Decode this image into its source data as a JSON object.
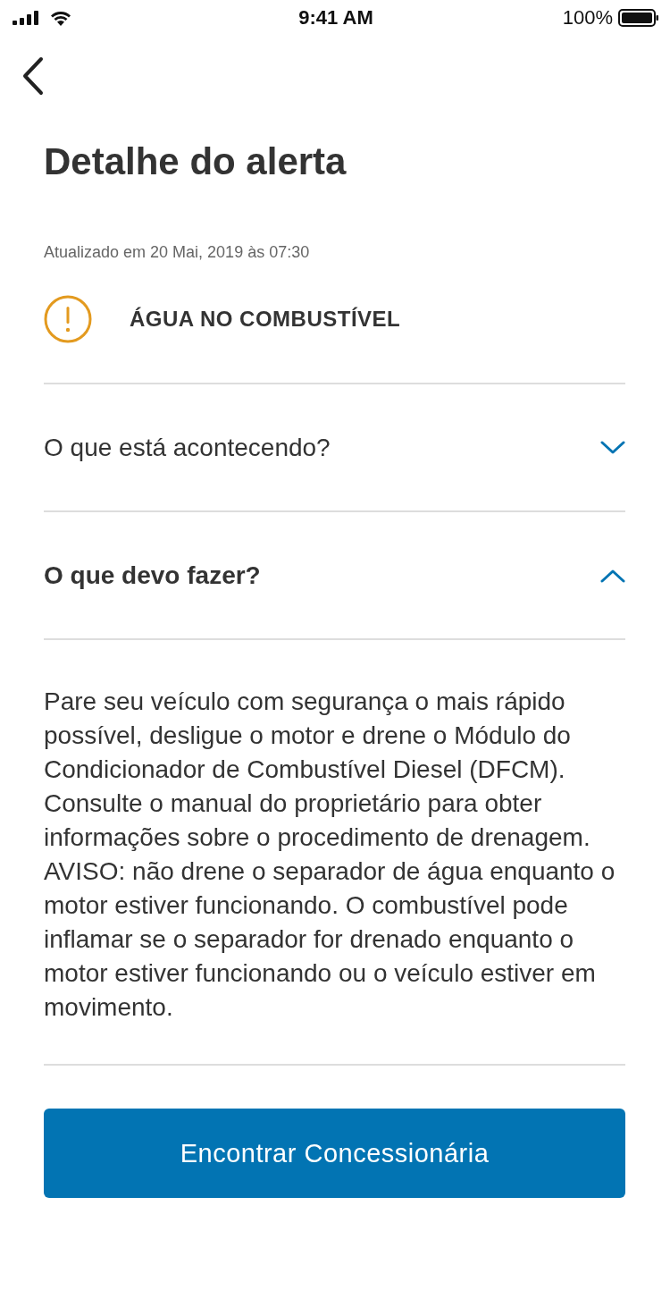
{
  "status_bar": {
    "time": "9:41 AM",
    "battery": "100%"
  },
  "title": "Detalhe do alerta",
  "updated": "Atualizado em 20 Mai, 2019 às 07:30",
  "alert": {
    "label": "ÁGUA NO COMBUSTÍVEL"
  },
  "sections": [
    {
      "question": "O que está acontecendo?",
      "expanded": false
    },
    {
      "question": "O que devo fazer?",
      "expanded": true,
      "body": "Pare seu veículo com segurança o mais rápido possível, desligue o motor e drene o Módulo do Condicionador de Combustível Diesel (DFCM). Consulte o manual do proprietário para obter informações sobre o procedimento de drenagem. AVISO: não drene o separador de água enquanto o motor estiver funcionando. O combustível pode inflamar se o separador for drenado enquanto o motor estiver funcionando ou o veículo estiver em movimento."
    }
  ],
  "button": "Encontrar Concessionária"
}
